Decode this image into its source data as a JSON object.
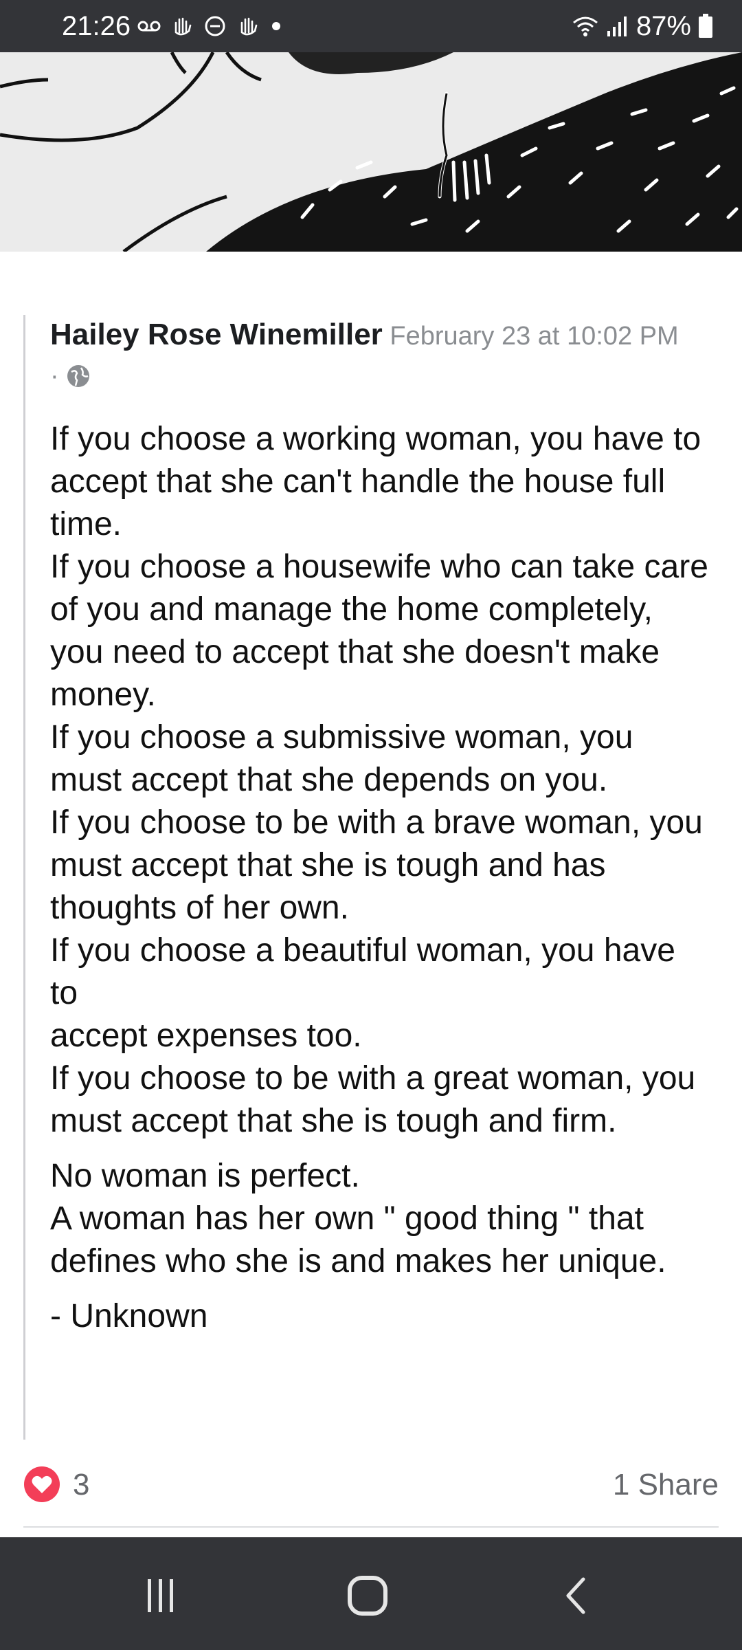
{
  "status_bar": {
    "time": "21:26",
    "battery_percent": "87%",
    "icons_left": [
      "voicemail-icon",
      "hand-wave-icon",
      "do-not-disturb-icon",
      "hand-wave-icon",
      "notification-dot-icon"
    ],
    "icons_right": [
      "wifi-icon",
      "signal-icon",
      "battery-icon"
    ]
  },
  "post": {
    "author": "Hailey Rose Winemiller",
    "timestamp": "February 23 at 10:02 PM",
    "separator": " · ",
    "privacy_icon": "globe-icon",
    "paragraphs": [
      "If you choose a working woman, you have to accept that she can't handle the house full time.",
      "If you choose a housewife who can take care of you and manage the home completely, you need to accept that she doesn't make money.",
      "If you choose a submissive woman, you must accept that she depends on you.",
      "If you choose to be with a brave woman, you must accept that she is tough and has thoughts of her own.",
      "If you choose a beautiful woman, you have to",
      "accept expenses too.",
      "If you choose to be with a great woman, you must accept that she is tough and firm.",
      "No woman is perfect.",
      "A woman has her own \" good thing \" that defines who she is and makes her unique.",
      "- Unknown"
    ]
  },
  "reactions": {
    "icon": "heart-icon",
    "count": "3",
    "shares": "1 Share"
  },
  "nav_bar": {
    "buttons": [
      "recent-apps-icon",
      "home-icon",
      "back-icon"
    ]
  },
  "colors": {
    "system_bar": "#333438",
    "heart": "#f33e58",
    "meta_text": "#8a8d91"
  }
}
